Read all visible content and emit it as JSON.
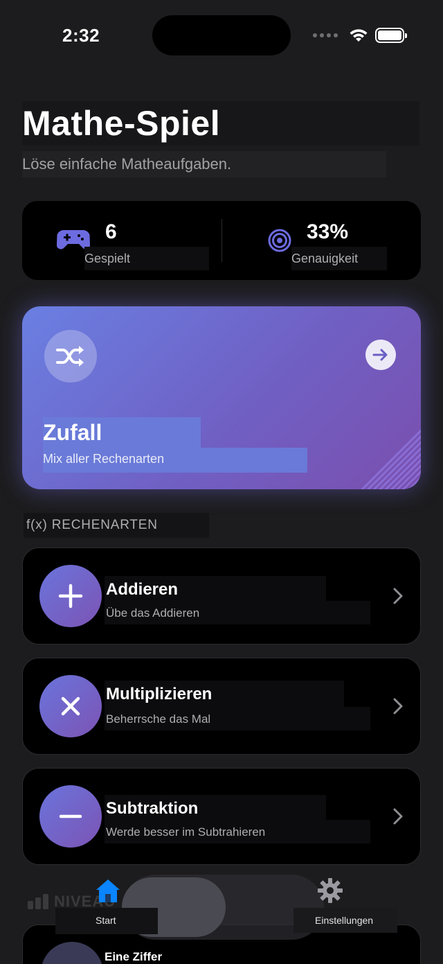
{
  "status": {
    "time": "2:32"
  },
  "header": {
    "title": "Mathe-Spiel",
    "subtitle": "Löse einfache Matheaufgaben."
  },
  "stats": [
    {
      "value": "6",
      "label": "Gespielt",
      "icon": "gamepad-icon"
    },
    {
      "value": "33%",
      "label": "Genauigkeit",
      "icon": "target-icon"
    }
  ],
  "hero": {
    "title": "Zufall",
    "subtitle": "Mix aller Rechenarten",
    "icon": "shuffle-icon"
  },
  "section": {
    "label": "f(x) RECHENARTEN"
  },
  "operations": [
    {
      "title": "Addieren",
      "subtitle": "Übe das Addieren",
      "icon": "plus-icon"
    },
    {
      "title": "Multiplizieren",
      "subtitle": "Beherrsche das Mal",
      "icon": "times-icon"
    },
    {
      "title": "Subtraktion",
      "subtitle": "Werde besser im Subtrahieren",
      "icon": "minus-icon"
    }
  ],
  "level": {
    "heading": "NIVEAU",
    "first_item": "Eine Ziffer"
  },
  "tabbar": {
    "start": "Start",
    "settings": "Einstellungen"
  },
  "colors": {
    "accent_start": "#6a7fe2",
    "accent_end": "#7a4fae",
    "tab_active": "#0a84ff"
  }
}
